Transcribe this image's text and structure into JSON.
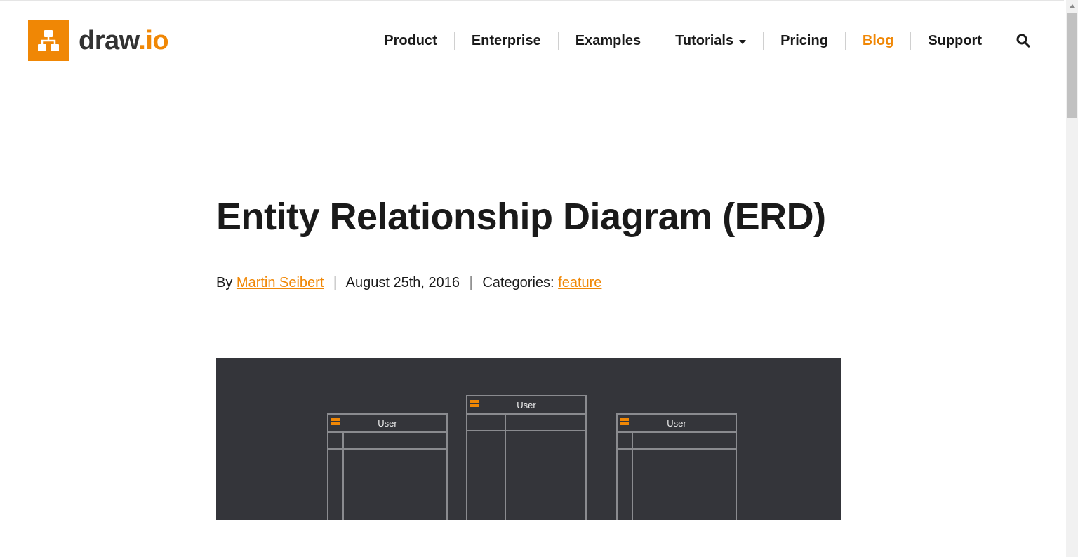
{
  "brand": {
    "name_a": "draw",
    "name_b": ".io"
  },
  "nav": {
    "items": [
      {
        "label": "Product",
        "active": false,
        "dropdown": false
      },
      {
        "label": "Enterprise",
        "active": false,
        "dropdown": false
      },
      {
        "label": "Examples",
        "active": false,
        "dropdown": false
      },
      {
        "label": "Tutorials",
        "active": false,
        "dropdown": true
      },
      {
        "label": "Pricing",
        "active": false,
        "dropdown": false
      },
      {
        "label": "Blog",
        "active": true,
        "dropdown": false
      },
      {
        "label": "Support",
        "active": false,
        "dropdown": false
      }
    ]
  },
  "post": {
    "title": "Entity Relationship Diagram (ERD)",
    "by_label": "By ",
    "author": "Martin Seibert",
    "date": "August 25th, 2016",
    "categories_label": "Categories: ",
    "category": "feature"
  },
  "hero": {
    "tables": [
      {
        "title": "User"
      },
      {
        "title": "User"
      },
      {
        "title": "User"
      }
    ]
  },
  "colors": {
    "accent": "#f08705",
    "hero_bg": "#34353a",
    "hero_line": "#8a8b8f"
  }
}
